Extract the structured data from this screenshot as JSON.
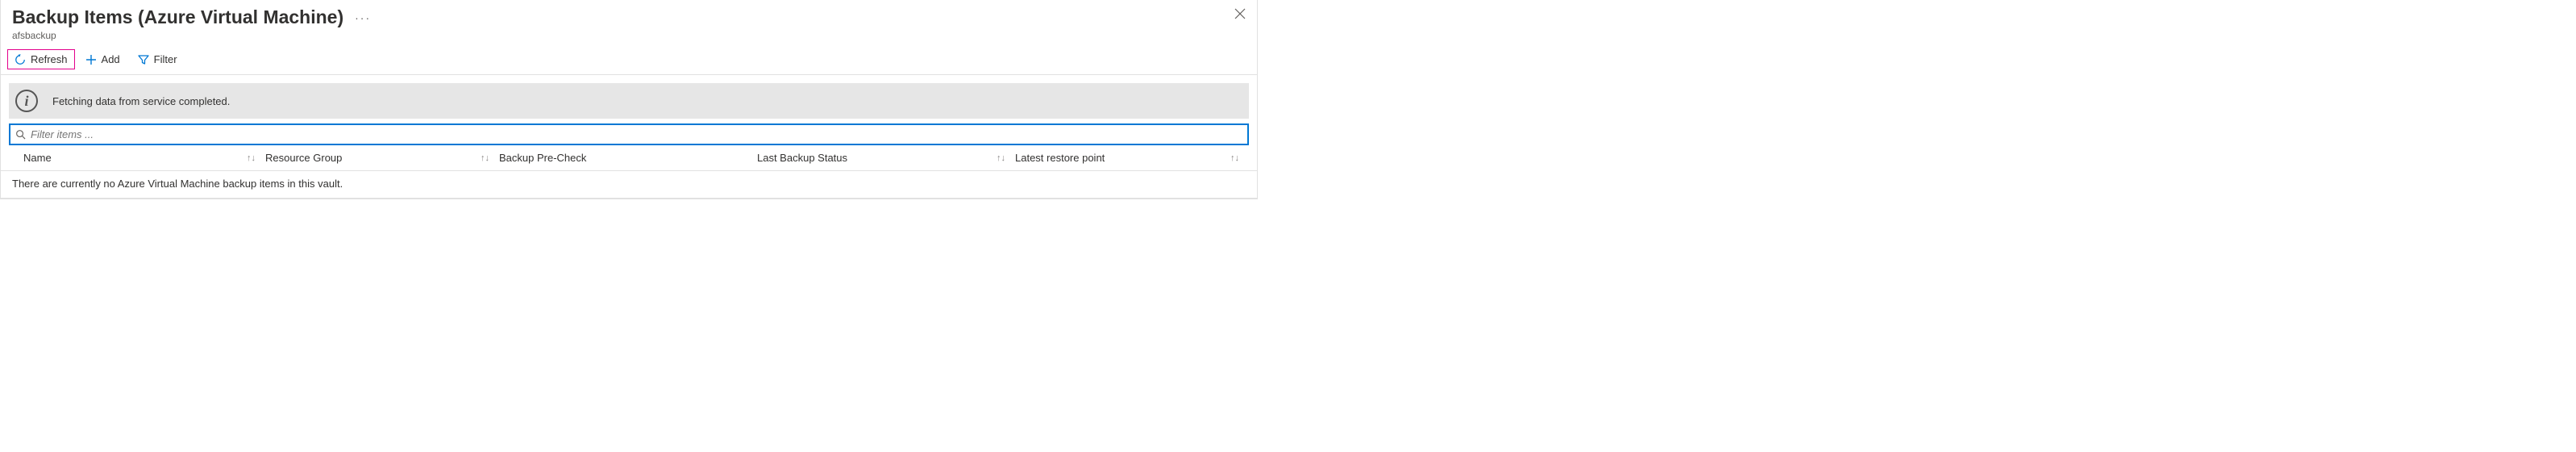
{
  "header": {
    "title": "Backup Items (Azure Virtual Machine)",
    "more": "···",
    "subtitle": "afsbackup"
  },
  "toolbar": {
    "refresh": "Refresh",
    "add": "Add",
    "filter": "Filter"
  },
  "info": {
    "message": "Fetching data from service completed."
  },
  "filter": {
    "placeholder": "Filter items ..."
  },
  "columns": {
    "name": "Name",
    "resource_group": "Resource Group",
    "pre_check": "Backup Pre-Check",
    "last_status": "Last Backup Status",
    "restore_point": "Latest restore point"
  },
  "empty_text": "There are currently no Azure Virtual Machine backup items in this vault."
}
